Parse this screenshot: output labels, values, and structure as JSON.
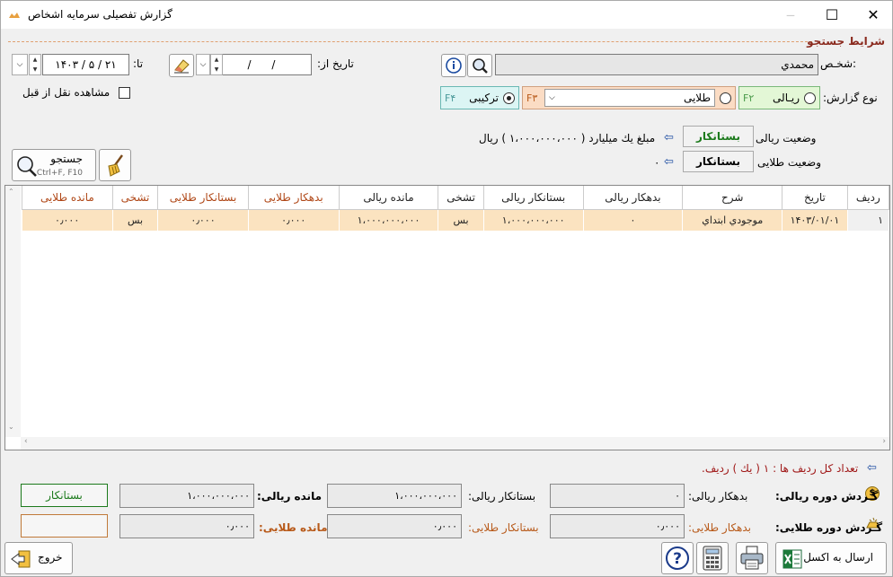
{
  "window": {
    "title": "گزارش تفصیلی سرمایه اشخاص",
    "minimize": "‒",
    "maximize": "☐",
    "close": "✕"
  },
  "search_section": {
    "title": "شرایط جستجو"
  },
  "person": {
    "label": "شخـص:",
    "value": "محمدي"
  },
  "date_from": {
    "label": "تاریخ از:",
    "value": "/      /"
  },
  "date_to": {
    "label": "تا:",
    "value": "۲۱ / ۵ / ۱۴۰۳"
  },
  "show_transfer": {
    "label": "مشاهده نقل از قبل"
  },
  "report_type": {
    "label": "نوع گزارش:",
    "options": [
      {
        "label": "ریـالی",
        "key": "F۲",
        "selected": false
      },
      {
        "label": "طلایی",
        "key": "F۳",
        "selected": false
      },
      {
        "label": "ترکیبی",
        "key": "F۴",
        "selected": true
      }
    ]
  },
  "rial_status": {
    "label": "وضعیت ریالی",
    "badge": "بستانکار",
    "text": "مبلغ یك میلیارد  ( ۱،۰۰۰،۰۰۰،۰۰۰ ) ریال"
  },
  "gold_status": {
    "label": "وضعیت طلایی",
    "badge": "بستانکار",
    "text": "۰"
  },
  "search_button": {
    "label": "جستجو",
    "shortcut": "Ctrl+F, F10"
  },
  "table": {
    "columns": [
      "ردیف",
      "تاریخ",
      "شرح",
      "بدهکار ریالی",
      "بستانکار ریالی",
      "تشخی",
      "مانده ریالی",
      "بدهکار طلایی",
      "بستانکار طلایی",
      "تشخی",
      "مانده طلایی"
    ],
    "rows": [
      [
        "۱",
        "۱۴۰۳/۰۱/۰۱",
        "موجودي ابتداي",
        "۰",
        "۱،۰۰۰،۰۰۰،۰۰۰",
        "بس",
        "۱،۰۰۰،۰۰۰،۰۰۰",
        "۰٫۰۰۰",
        "۰٫۰۰۰",
        "بس",
        "۰٫۰۰۰"
      ]
    ]
  },
  "row_count": {
    "text": "تعداد کل ردیف ها : ۱ ( یك ) ردیف."
  },
  "rial_summary": {
    "title": "گـردش دوره ریالی:",
    "debit_label": "بدهکار ریالی:",
    "debit": "۰",
    "credit_label": "بستانکار ریالی:",
    "credit": "۱،۰۰۰،۰۰۰،۰۰۰",
    "balance_label": "مانده ریالی:",
    "balance": "۱،۰۰۰،۰۰۰،۰۰۰",
    "status": "بستانکار"
  },
  "gold_summary": {
    "title": "گـردش دوره طلایی:",
    "debit_label": "بدهکار طلایی:",
    "debit": "۰٫۰۰۰",
    "credit_label": "بستانکار طلایی:",
    "credit": "۰٫۰۰۰",
    "balance_label": "مانده طلایی:",
    "balance": "۰٫۰۰۰",
    "status": ""
  },
  "footer": {
    "excel": "ارسال به اکسل",
    "exit": "خروج"
  },
  "colors": {
    "accent": "#8a2a1e",
    "header_text": "#b04818",
    "row_bg": "#fbe3c0",
    "green": "#1c7a1c",
    "gold_label": "#b85a1a"
  }
}
